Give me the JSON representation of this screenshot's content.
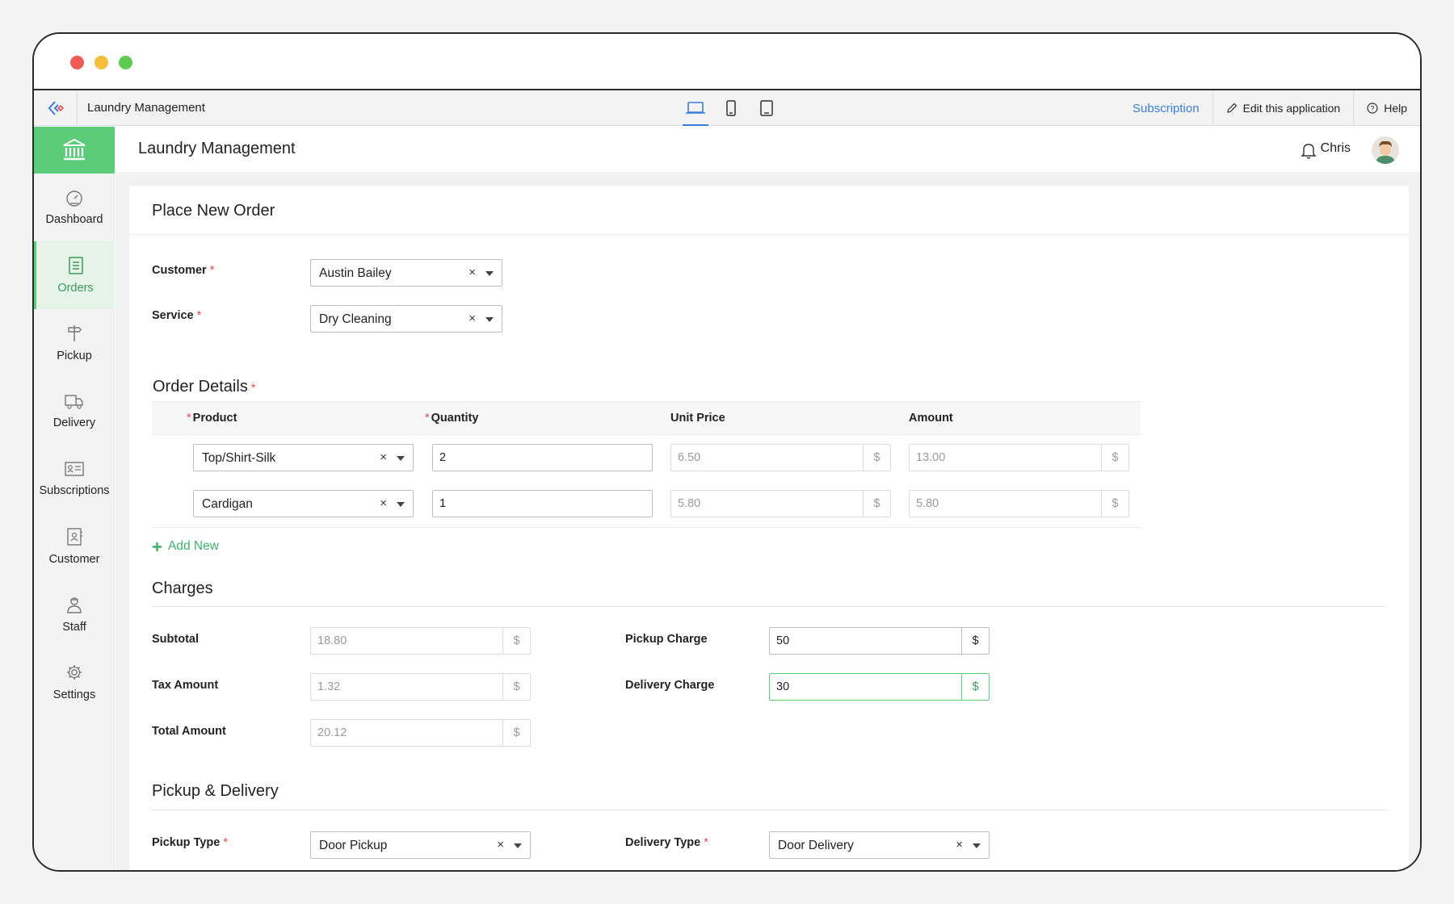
{
  "app": {
    "name": "Laundry Management",
    "device_modes": [
      "desktop-icon",
      "tablet-icon",
      "mobile-icon"
    ],
    "top_actions": {
      "subscription": "Subscription",
      "edit": "Edit this application",
      "help": "Help"
    }
  },
  "header": {
    "title": "Laundry Management",
    "user": "Chris"
  },
  "sidebar": {
    "items": [
      {
        "label": "Dashboard",
        "icon": "dashboard-icon",
        "active": false
      },
      {
        "label": "Orders",
        "icon": "orders-icon",
        "active": true
      },
      {
        "label": "Pickup",
        "icon": "signpost-icon",
        "active": false
      },
      {
        "label": "Delivery",
        "icon": "truck-icon",
        "active": false
      },
      {
        "label": "Subscriptions",
        "icon": "id-card-icon",
        "active": false
      },
      {
        "label": "Customer",
        "icon": "contact-book-icon",
        "active": false
      },
      {
        "label": "Staff",
        "icon": "staff-icon",
        "active": false
      },
      {
        "label": "Settings",
        "icon": "gear-icon",
        "active": false
      }
    ]
  },
  "form": {
    "title": "Place New Order",
    "customer": {
      "label": "Customer",
      "value": "Austin Bailey"
    },
    "service": {
      "label": "Service",
      "value": "Dry Cleaning"
    },
    "order_details": {
      "title": "Order Details",
      "columns": [
        "Product",
        "Quantity",
        "Unit Price",
        "Amount"
      ],
      "rows": [
        {
          "product": "Top/Shirt-Silk",
          "quantity": "2",
          "unit_price": "6.50",
          "amount": "13.00"
        },
        {
          "product": "Cardigan",
          "quantity": "1",
          "unit_price": "5.80",
          "amount": "5.80"
        }
      ],
      "add_new": "Add New"
    },
    "charges": {
      "title": "Charges",
      "subtotal": {
        "label": "Subtotal",
        "value": "18.80"
      },
      "tax": {
        "label": "Tax Amount",
        "value": "1.32"
      },
      "total": {
        "label": "Total Amount",
        "value": "20.12"
      },
      "pickup_charge": {
        "label": "Pickup Charge",
        "value": "50"
      },
      "delivery_charge": {
        "label": "Delivery Charge",
        "value": "30"
      },
      "currency": "$"
    },
    "pickup_delivery": {
      "title": "Pickup & Delivery",
      "pickup_type": {
        "label": "Pickup Type",
        "value": "Door Pickup"
      },
      "delivery_type": {
        "label": "Delivery Type",
        "value": "Door Delivery"
      }
    },
    "clear_symbol": "×",
    "required_mark": "*"
  },
  "colors": {
    "accent": "#5ccc7b",
    "link": "#3b7dd8",
    "required": "#e04a4a"
  }
}
